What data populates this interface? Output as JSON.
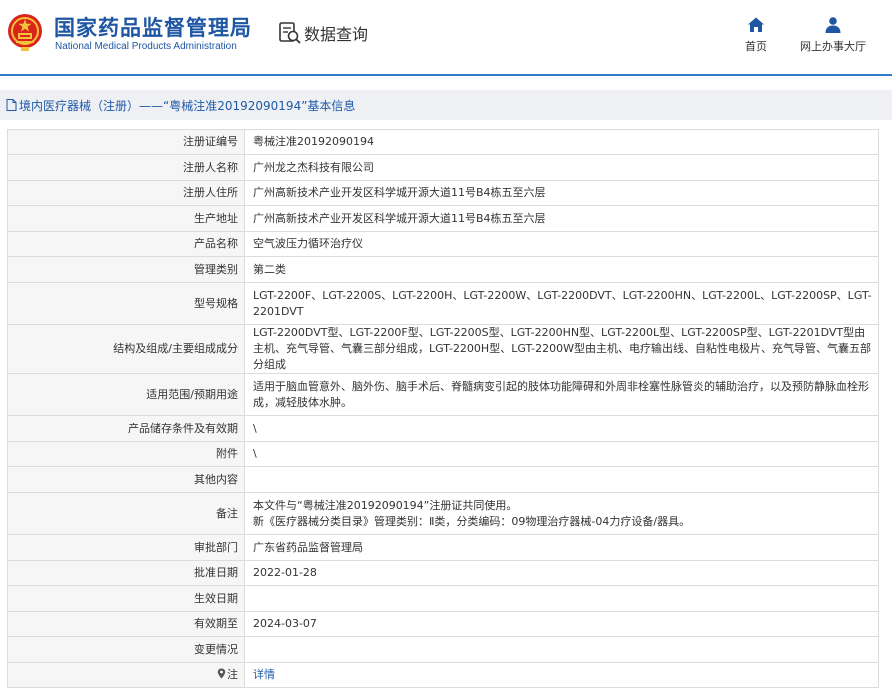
{
  "header": {
    "org_cn": "国家药品监督管理局",
    "org_en": "National Medical Products Administration",
    "search_label": "数据查询",
    "nav": [
      {
        "label": "首页",
        "icon": "home-icon"
      },
      {
        "label": "网上办事大厅",
        "icon": "user-icon"
      }
    ]
  },
  "breadcrumb": {
    "text": "境内医疗器械（注册）——“粤械注准20192090194”基本信息"
  },
  "colors": {
    "brand_blue": "#1e56a3",
    "header_line": "#2f7ccf",
    "link": "#1e5aa8",
    "emblem_red": "#d9241c",
    "emblem_gold": "#f3c23a"
  },
  "detail": {
    "rows": [
      {
        "label": "注册证编号",
        "value": "粤械注准20192090194"
      },
      {
        "label": "注册人名称",
        "value": "广州龙之杰科技有限公司"
      },
      {
        "label": "注册人住所",
        "value": "广州高新技术产业开发区科学城开源大道11号B4栋五至六层"
      },
      {
        "label": "生产地址",
        "value": "广州高新技术产业开发区科学城开源大道11号B4栋五至六层"
      },
      {
        "label": "产品名称",
        "value": "空气波压力循环治疗仪"
      },
      {
        "label": "管理类别",
        "value": "第二类"
      },
      {
        "label": "型号规格",
        "value": "LGT-2200F、LGT-2200S、LGT-2200H、LGT-2200W、LGT-2200DVT、LGT-2200HN、LGT-2200L、LGT-2200SP、LGT-2201DVT"
      },
      {
        "label": "结构及组成/主要组成成分",
        "value": "LGT-2200DVT型、LGT-2200F型、LGT-2200S型、LGT-2200HN型、LGT-2200L型、LGT-2200SP型、LGT-2201DVT型由主机、充气导管、气囊三部分组成，LGT-2200H型、LGT-2200W型由主机、电疗输出线、自粘性电极片、充气导管、气囊五部分组成"
      },
      {
        "label": "适用范围/预期用途",
        "value": "适用于脑血管意外、脑外伤、脑手术后、脊髓病变引起的肢体功能障碍和外周非栓塞性脉管炎的辅助治疗，以及预防静脉血栓形成，减轻肢体水肿。"
      },
      {
        "label": "产品储存条件及有效期",
        "value": "\\"
      },
      {
        "label": "附件",
        "value": "\\"
      },
      {
        "label": "其他内容",
        "value": ""
      },
      {
        "label": "备注",
        "value_lines": [
          "本文件与“粤械注准20192090194”注册证共同使用。",
          "新《医疗器械分类目录》管理类别：Ⅱ类，分类编码：09物理治疗器械-04力疗设备/器具。"
        ]
      },
      {
        "label": "审批部门",
        "value": "广东省药品监督管理局"
      },
      {
        "label": "批准日期",
        "value": "2022-01-28"
      },
      {
        "label": "生效日期",
        "value": ""
      },
      {
        "label": "有效期至",
        "value": "2024-03-07"
      },
      {
        "label": "变更情况",
        "value": ""
      },
      {
        "label": "注",
        "value": "详情",
        "label_icon": "pin-icon",
        "value_is_link": true
      }
    ]
  }
}
